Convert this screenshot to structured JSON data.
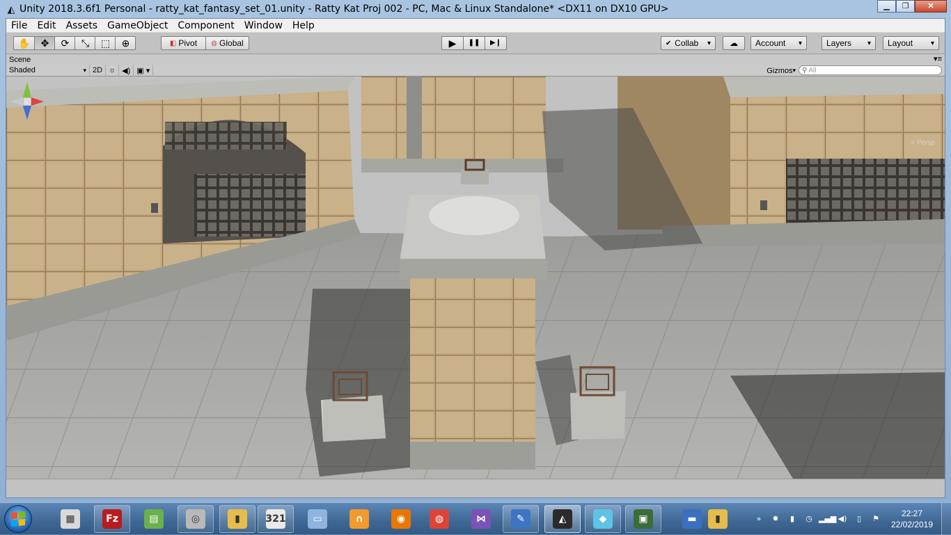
{
  "window": {
    "title": "Unity 2018.3.6f1 Personal - ratty_kat_fantasy_set_01.unity - Ratty Kat Proj 002 - PC, Mac & Linux Standalone* <DX11 on DX10 GPU>",
    "icon": "unity-icon",
    "controls": {
      "minimize": "▁",
      "maximize": "❐",
      "close": "✕"
    }
  },
  "menubar": {
    "items": [
      "File",
      "Edit",
      "Assets",
      "GameObject",
      "Component",
      "Window",
      "Help"
    ]
  },
  "toolbar": {
    "transform_tools": [
      {
        "name": "hand-tool-icon",
        "glyph": "✋"
      },
      {
        "name": "move-tool-icon",
        "glyph": "✥"
      },
      {
        "name": "rotate-tool-icon",
        "glyph": "⟳"
      },
      {
        "name": "scale-tool-icon",
        "glyph": "⤡"
      },
      {
        "name": "rect-tool-icon",
        "glyph": "⬚"
      },
      {
        "name": "transform-tool-icon",
        "glyph": "⊕"
      }
    ],
    "pivot_label": "Pivot",
    "global_label": "Global",
    "play_glyph": "▶",
    "pause_glyph": "❚❚",
    "step_glyph": "▶❙",
    "collab_label": "Collab",
    "account_label": "Account",
    "layers_label": "Layers",
    "layout_label": "Layout"
  },
  "scene": {
    "tab_label": "Scene",
    "shading_mode": "Shaded",
    "mode_2d": "2D",
    "gizmos_label": "Gizmos",
    "search_placeholder": "All",
    "persp_label": "< Persp"
  },
  "taskbar": {
    "apps": [
      {
        "name": "calculator-app",
        "color": "#d9d9d9",
        "glyph": "▦",
        "state": "normal"
      },
      {
        "name": "filezilla-app",
        "color": "#b81c1c",
        "glyph": "Fz",
        "state": "running"
      },
      {
        "name": "green-app",
        "color": "#6ab04c",
        "glyph": "▤",
        "state": "normal"
      },
      {
        "name": "disc-app",
        "color": "#b9b9b9",
        "glyph": "◎",
        "state": "running"
      },
      {
        "name": "folder-app",
        "color": "#e6bd4a",
        "glyph": "▮",
        "state": "running"
      },
      {
        "name": "video-app",
        "color": "#e9e9e9",
        "glyph": "321",
        "state": "running"
      },
      {
        "name": "remote-desktop-app",
        "color": "#8fb4de",
        "glyph": "▭",
        "state": "normal"
      },
      {
        "name": "audacity-app",
        "color": "#f29a2e",
        "glyph": "∩",
        "state": "normal"
      },
      {
        "name": "blender-app",
        "color": "#ea7600",
        "glyph": "◉",
        "state": "normal"
      },
      {
        "name": "chrome-app",
        "color": "#db4437",
        "glyph": "◍",
        "state": "normal"
      },
      {
        "name": "visual-studio-app",
        "color": "#7b52b8",
        "glyph": "⋈",
        "state": "normal"
      },
      {
        "name": "paint-app",
        "color": "#3d74c4",
        "glyph": "✎",
        "state": "running"
      },
      {
        "name": "unity-app",
        "color": "#2b2b2b",
        "glyph": "◭",
        "state": "active"
      },
      {
        "name": "glass-app",
        "color": "#5ec3e4",
        "glyph": "◆",
        "state": "running"
      },
      {
        "name": "monitor-app",
        "color": "#3a6d3a",
        "glyph": "▣",
        "state": "running"
      },
      {
        "name": "computer-app",
        "color": "#3c6fbf",
        "glyph": "▬",
        "state": "normal"
      },
      {
        "name": "folder2-app",
        "color": "#e6bd4a",
        "glyph": "▮",
        "state": "normal"
      }
    ],
    "tray": [
      {
        "name": "tray-expand-icon",
        "glyph": "»"
      },
      {
        "name": "tray-avast-icon",
        "glyph": "✸"
      },
      {
        "name": "tray-green-icon",
        "glyph": "▮"
      },
      {
        "name": "tray-clock-icon",
        "glyph": "◷"
      },
      {
        "name": "tray-network-icon",
        "glyph": "▂▄▆"
      },
      {
        "name": "tray-volume-icon",
        "glyph": "◀)"
      },
      {
        "name": "tray-device-icon",
        "glyph": "▯"
      },
      {
        "name": "tray-flag-icon",
        "glyph": "⚑"
      }
    ],
    "time": "22:27",
    "date": "22/02/2019"
  }
}
